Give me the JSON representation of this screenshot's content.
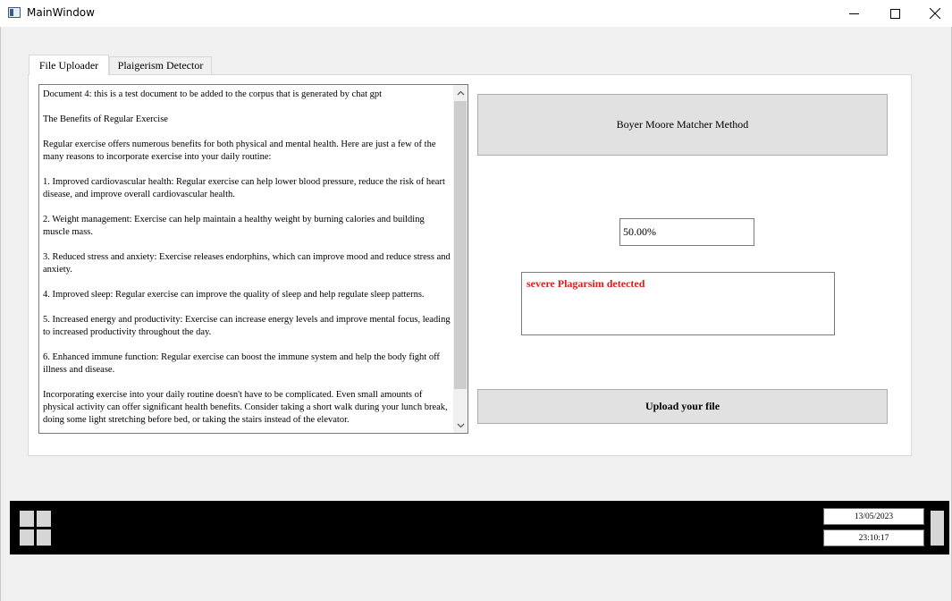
{
  "window": {
    "title": "MainWindow",
    "icons": {
      "app": "app-window-icon",
      "minimize": "minimize-icon",
      "maximize": "maximize-icon",
      "close": "close-icon"
    }
  },
  "tabs": [
    {
      "label": "File Uploader",
      "active": true
    },
    {
      "label": "Plaigerism Detector",
      "active": false
    }
  ],
  "document": {
    "text": "Document 4: this is a test document to be added to the corpus that is generated by chat gpt\n\nThe Benefits of Regular Exercise\n\nRegular exercise offers numerous benefits for both physical and mental health. Here are just a few of the many reasons to incorporate exercise into your daily routine:\n\n1. Improved cardiovascular health: Regular exercise can help lower blood pressure, reduce the risk of heart disease, and improve overall cardiovascular health.\n\n2. Weight management: Exercise can help maintain a healthy weight by burning calories and building muscle mass.\n\n3. Reduced stress and anxiety: Exercise releases endorphins, which can improve mood and reduce stress and anxiety.\n\n4. Improved sleep: Regular exercise can improve the quality of sleep and help regulate sleep patterns.\n\n5. Increased energy and productivity: Exercise can increase energy levels and improve mental focus, leading to increased productivity throughout the day.\n\n6. Enhanced immune function: Regular exercise can boost the immune system and help the body fight off illness and disease.\n\nIncorporating exercise into your daily routine doesn't have to be complicated. Even small amounts of physical activity can offer significant health benefits. Consider taking a short walk during your lunch break, doing some light stretching before bed, or taking the stairs instead of the elevator."
  },
  "buttons": {
    "method": "Boyer Moore Matcher Method",
    "upload": "Upload your file"
  },
  "result": {
    "percentage": "50.00%",
    "message": "severe Plagarsim detected",
    "message_color": "#e31b1b"
  },
  "taskbar": {
    "date": "13/05/2023",
    "time": "23:10:17",
    "start_icon": "windows-logo-icon"
  }
}
